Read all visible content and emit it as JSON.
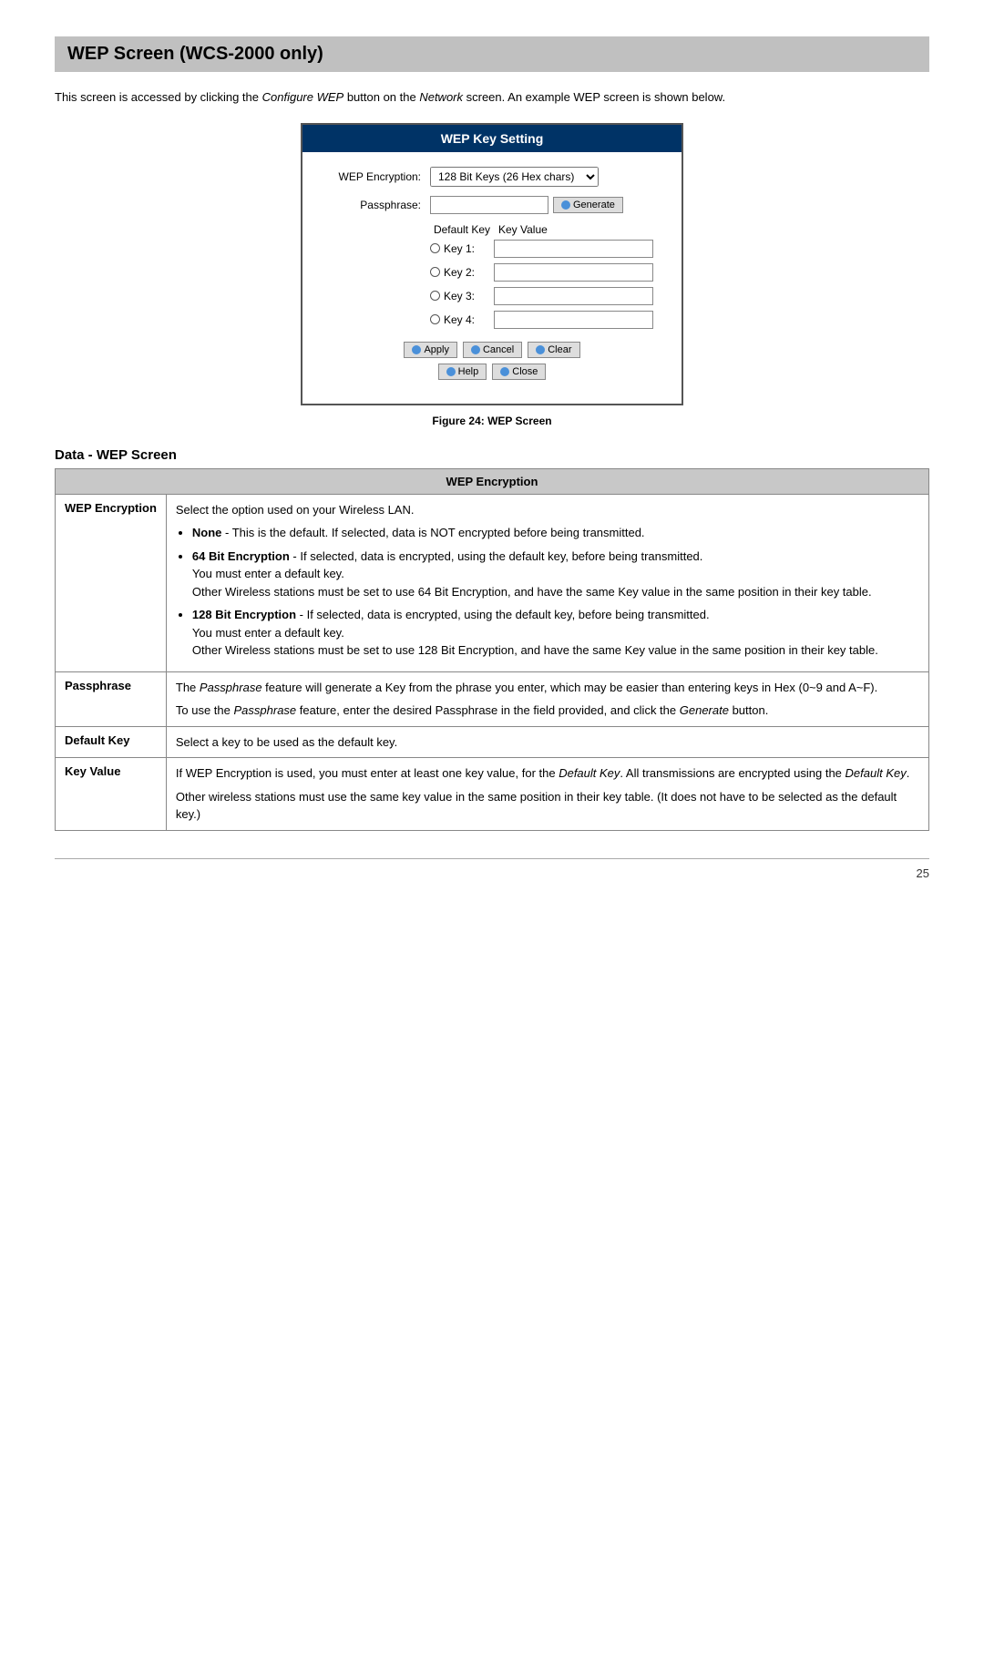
{
  "page": {
    "title": "WEP Screen (WCS-2000 only)",
    "intro": {
      "text_before_italic1": "This screen is accessed by clicking the ",
      "italic1": "Configure WEP",
      "text_after_italic1": " button on the ",
      "italic2": "Network",
      "text_after_italic2": " screen. An example WEP screen is shown below."
    }
  },
  "wep_dialog": {
    "header": "WEP Key Setting",
    "encryption_label": "WEP Encryption:",
    "encryption_value": "128 Bit Keys (26 Hex chars)",
    "passphrase_label": "Passphrase:",
    "generate_btn": "Generate",
    "col_default_key": "Default Key",
    "col_key_value": "Key Value",
    "keys": [
      {
        "label": "Key 1:"
      },
      {
        "label": "Key 2:"
      },
      {
        "label": "Key 3:"
      },
      {
        "label": "Key 4:"
      }
    ],
    "buttons_row1": {
      "apply": "Apply",
      "cancel": "Cancel",
      "clear": "Clear"
    },
    "buttons_row2": {
      "help": "Help",
      "close": "Close"
    }
  },
  "figure_caption": "Figure 24: WEP Screen",
  "data_section": {
    "title": "Data - WEP Screen",
    "table_header": "WEP Encryption",
    "rows": [
      {
        "label": "WEP Encryption",
        "intro": "Select the option used on your Wireless LAN.",
        "bullets": [
          {
            "bold": "None",
            "text": " - This is the default. If selected, data is NOT encrypted before being transmitted."
          },
          {
            "bold": "64 Bit Encryption",
            "text": " - If selected, data is encrypted, using the default key, before being transmitted.\nYou must enter a default key.\nOther Wireless stations must be set to use 64 Bit Encryption, and have the same Key value in the same position in their key table."
          },
          {
            "bold": "128 Bit Encryption",
            "text": " - If selected, data is encrypted, using the default key, before being transmitted.\nYou must enter a default key.\nOther Wireless stations must be set to use 128 Bit Encryption, and have the same Key value in the same position in their key table."
          }
        ]
      },
      {
        "label": "Passphrase",
        "paragraphs": [
          "The <em>Passphrase</em> feature will generate a Key from the phrase you enter, which may be easier than entering keys in Hex (0~9 and A~F).",
          "To use the <em>Passphrase</em> feature, enter the desired Passphrase in the field provided, and click the <em>Generate</em> button."
        ]
      },
      {
        "label": "Default Key",
        "paragraphs": [
          "Select a key to be used as the default key."
        ]
      },
      {
        "label": "Key Value",
        "paragraphs": [
          "If WEP Encryption is used, you must enter at least one key value, for the <em>Default Key</em>. All transmissions are encrypted using the <em>Default Key</em>.",
          "Other wireless stations must use the same key value in the same position in their key table. (It does not have to be selected as the default key.)"
        ]
      }
    ]
  },
  "footer": {
    "page_number": "25"
  }
}
